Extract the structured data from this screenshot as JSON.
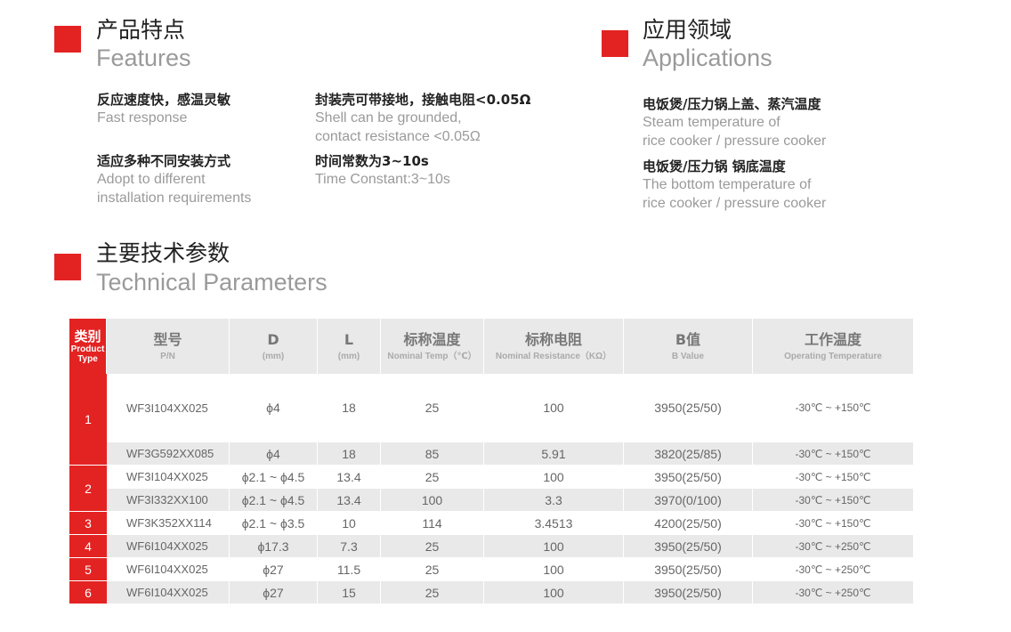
{
  "features": {
    "title_cn": "产品特点",
    "title_en": "Features",
    "items": [
      {
        "cn": "反应速度快，感温灵敏",
        "en": [
          "Fast response"
        ]
      },
      {
        "cn": "封装壳可带接地，接触电阻<0.05Ω",
        "en": [
          "Shell can be grounded,",
          "contact resistance <0.05Ω"
        ]
      },
      {
        "cn": "适应多种不同安装方式",
        "en": [
          "Adopt to different",
          "installation requirements"
        ]
      },
      {
        "cn": "时间常数为3~10s",
        "en": [
          "Time Constant:3~10s"
        ]
      }
    ]
  },
  "applications": {
    "title_cn": "应用领域",
    "title_en": "Applications",
    "items": [
      {
        "cn": "电饭煲/压力锅上盖、蒸汽温度",
        "en": [
          "Steam temperature of",
          "rice cooker / pressure cooker"
        ]
      },
      {
        "cn": "电饭煲/压力锅 锅底温度",
        "en": [
          "The bottom temperature of",
          "rice cooker / pressure cooker"
        ]
      }
    ]
  },
  "technical": {
    "title_cn": "主要技术参数",
    "title_en": "Technical Parameters"
  },
  "table": {
    "headers": {
      "type": {
        "cn": "类别",
        "en": "Product Type"
      },
      "pn": {
        "cn": "型号",
        "en": "P/N"
      },
      "d": {
        "cn": "D",
        "en": "(mm)"
      },
      "l": {
        "cn": "L",
        "en": "(mm)"
      },
      "temp": {
        "cn": "标称温度",
        "en": "Nominal Temp（℃）"
      },
      "res": {
        "cn": "标称电阻",
        "en": "Nominal Resistance（KΩ）"
      },
      "b": {
        "cn": "B值",
        "en": "B Value"
      },
      "op": {
        "cn": "工作温度",
        "en": "Operating Temperature"
      }
    },
    "types": [
      "1",
      "2",
      "3",
      "4",
      "5",
      "6"
    ],
    "rows": [
      {
        "pn": "WF3I104XX025",
        "d": "ϕ4",
        "l": "18",
        "temp": "25",
        "res": "100",
        "b": "3950(25/50)",
        "op": "-30℃ ~ +150℃"
      },
      {
        "pn": "WF3G592XX085",
        "d": "ϕ4",
        "l": "18",
        "temp": "85",
        "res": "5.91",
        "b": "3820(25/85)",
        "op": "-30℃ ~ +150℃"
      },
      {
        "pn": "WF3I104XX025",
        "d": "ϕ2.1 ~ ϕ4.5",
        "l": "13.4",
        "temp": "25",
        "res": "100",
        "b": "3950(25/50)",
        "op": "-30℃ ~ +150℃"
      },
      {
        "pn": "WF3I332XX100",
        "d": "ϕ2.1 ~ ϕ4.5",
        "l": "13.4",
        "temp": "100",
        "res": "3.3",
        "b": "3970(0/100)",
        "op": "-30℃ ~ +150℃"
      },
      {
        "pn": "WF3K352XX114",
        "d": "ϕ2.1 ~ ϕ3.5",
        "l": "10",
        "temp": "114",
        "res": "3.4513",
        "b": "4200(25/50)",
        "op": "-30℃ ~ +150℃"
      },
      {
        "pn": "WF6I104XX025",
        "d": "ϕ17.3",
        "l": "7.3",
        "temp": "25",
        "res": "100",
        "b": "3950(25/50)",
        "op": "-30℃ ~ +250℃"
      },
      {
        "pn": "WF6I104XX025",
        "d": "ϕ27",
        "l": "11.5",
        "temp": "25",
        "res": "100",
        "b": "3950(25/50)",
        "op": "-30℃ ~ +250℃"
      },
      {
        "pn": "WF6I104XX025",
        "d": "ϕ27",
        "l": "15",
        "temp": "25",
        "res": "100",
        "b": "3950(25/50)",
        "op": "-30℃ ~ +250℃"
      }
    ]
  },
  "colors": {
    "accent": "#e32322",
    "header_bg": "#e9e9e9",
    "muted_text": "#9a9a9a"
  }
}
